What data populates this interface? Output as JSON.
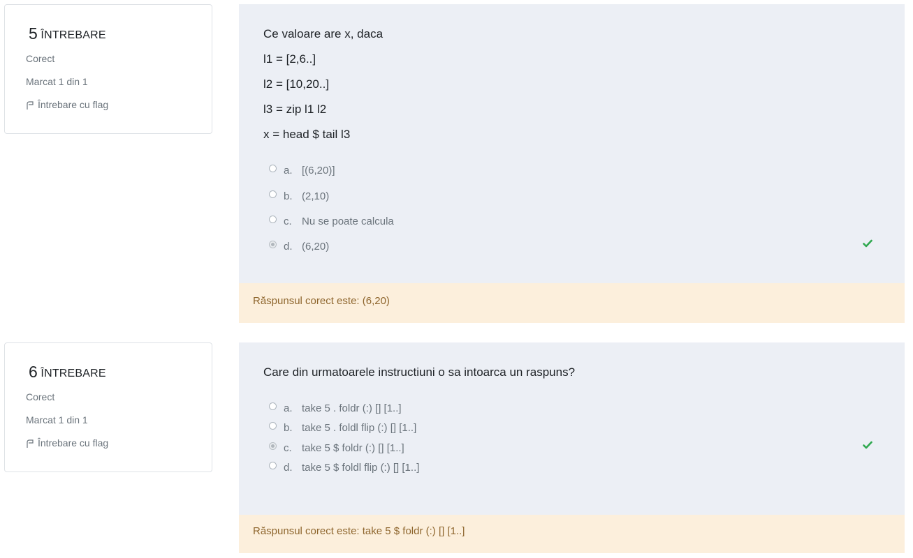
{
  "questions": [
    {
      "number": "5",
      "word": "ÎNTREBARE",
      "state": "Corect",
      "grade": "Marcat 1 din 1",
      "flag_label": "Întrebare cu flag",
      "text_lines": [
        "Ce valoare are x, daca",
        "l1 = [2,6..]",
        "l2 = [10,20..]",
        "l3 = zip l1 l2",
        "x = head $ tail l3"
      ],
      "options": [
        {
          "letter": "a.",
          "text": "[(6,20)]",
          "selected": false
        },
        {
          "letter": "b.",
          "text": "(2,10)",
          "selected": false
        },
        {
          "letter": "c.",
          "text": "Nu se poate calcula",
          "selected": false
        },
        {
          "letter": "d.",
          "text": "(6,20)",
          "selected": true
        }
      ],
      "correct_answer": "Răspunsul corect este: (6,20)"
    },
    {
      "number": "6",
      "word": "ÎNTREBARE",
      "state": "Corect",
      "grade": "Marcat 1 din 1",
      "flag_label": "Întrebare cu flag",
      "text_lines": [
        "Care din urmatoarele instructiuni o sa intoarca un raspuns?"
      ],
      "options": [
        {
          "letter": "a.",
          "text": "take 5 . foldr (:) [] [1..]",
          "selected": false
        },
        {
          "letter": "b.",
          "text": "take 5 . foldl flip (:) [] [1..]",
          "selected": false
        },
        {
          "letter": "c.",
          "text": "take 5 $ foldr (:) [] [1..]",
          "selected": true
        },
        {
          "letter": "d.",
          "text": "take 5 $ foldl flip (:) [] [1..]",
          "selected": false
        }
      ],
      "correct_answer": "Răspunsul corect este: take 5 $ foldr (:) [] [1..]"
    }
  ],
  "colors": {
    "content_bg": "#eceff5",
    "feedback_bg": "#fcefdc",
    "feedback_text": "#8e662e",
    "check": "#2fa84f"
  },
  "icons": {
    "flag": "flag-icon",
    "correct": "check-icon"
  }
}
